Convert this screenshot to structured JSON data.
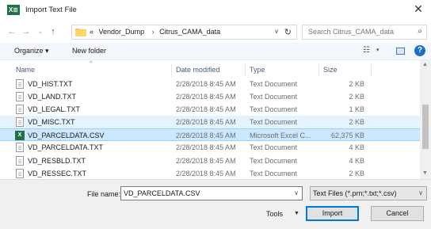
{
  "window": {
    "title": "Import Text File",
    "app_icon_text": "X≣",
    "close_glyph": "✕"
  },
  "nav": {
    "back": "←",
    "forward": "→",
    "history": "⌄",
    "up": "↑",
    "breadcrumb_prefix": "«",
    "crumbs": [
      "Vendor_Dump",
      "Citrus_CAMA_data"
    ],
    "crumb_separator": "›",
    "address_dropdown": "∨",
    "refresh": "↻",
    "search_placeholder": "Search Citrus_CAMA_data",
    "search_icon": "⌕"
  },
  "toolbar": {
    "organize_label": "Organize ▾",
    "new_folder_label": "New folder",
    "view_icon": "☷",
    "view_dropdown": "▾",
    "help_label": "?"
  },
  "columns": {
    "name": "Name",
    "date": "Date modified",
    "type": "Type",
    "size": "Size",
    "sort_caret": "^"
  },
  "files": [
    {
      "name": "VD_HIST.TXT",
      "date": "2/28/2018 8:45 AM",
      "type": "Text Document",
      "size": "2 KB",
      "kind": "text",
      "state": ""
    },
    {
      "name": "VD_LAND.TXT",
      "date": "2/28/2018 8:45 AM",
      "type": "Text Document",
      "size": "2 KB",
      "kind": "text",
      "state": ""
    },
    {
      "name": "VD_LEGAL.TXT",
      "date": "2/28/2018 8:45 AM",
      "type": "Text Document",
      "size": "1 KB",
      "kind": "text",
      "state": ""
    },
    {
      "name": "VD_MISC.TXT",
      "date": "2/28/2018 8:45 AM",
      "type": "Text Document",
      "size": "2 KB",
      "kind": "text",
      "state": "hover"
    },
    {
      "name": "VD_PARCELDATA.CSV",
      "date": "2/28/2018 8:45 AM",
      "type": "Microsoft Excel C...",
      "size": "62,375 KB",
      "kind": "excel",
      "state": "selected"
    },
    {
      "name": "VD_PARCELDATA.TXT",
      "date": "2/28/2018 8:45 AM",
      "type": "Text Document",
      "size": "4 KB",
      "kind": "text",
      "state": ""
    },
    {
      "name": "VD_RESBLD.TXT",
      "date": "2/28/2018 8:45 AM",
      "type": "Text Document",
      "size": "4 KB",
      "kind": "text",
      "state": ""
    },
    {
      "name": "VD_RESSEC.TXT",
      "date": "2/28/2018 8:45 AM",
      "type": "Text Document",
      "size": "2 KB",
      "kind": "text",
      "state": ""
    }
  ],
  "scrollbar": {
    "up": "▲",
    "down": "▼"
  },
  "footer": {
    "file_name_label": "File name:",
    "file_name_value": "VD_PARCELDATA.CSV",
    "file_name_dropdown": "∨",
    "file_type_value": "Text Files (*.prn;*.txt;*.csv)",
    "file_type_dropdown": "∨",
    "tools_label": "Tools",
    "tools_dropdown": "▼",
    "import_label": "Import",
    "cancel_label": "Cancel"
  },
  "colors": {
    "selected_row": "#cce8ff",
    "hover_row": "#e5f3ff",
    "excel_green": "#1e7145",
    "accent": "#0078d7"
  }
}
